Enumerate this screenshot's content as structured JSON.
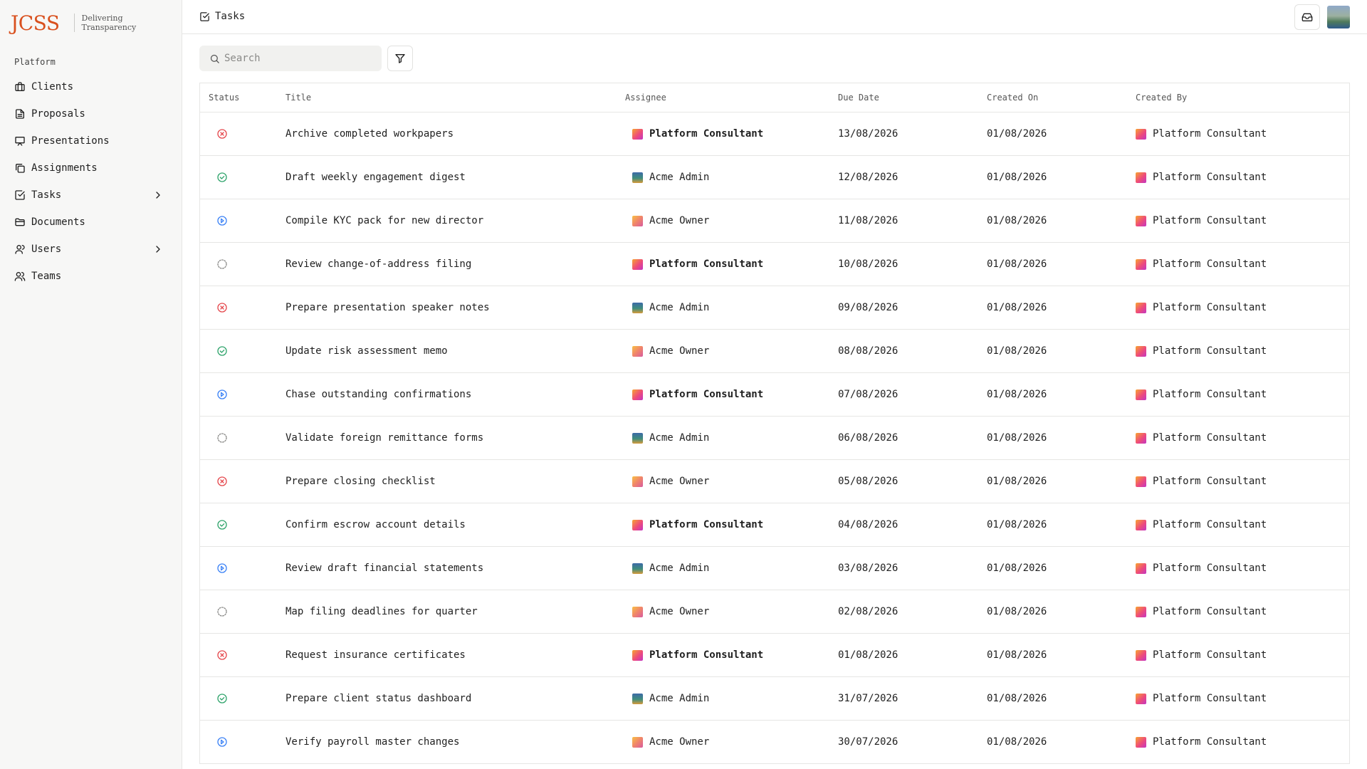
{
  "brand": {
    "logo": "JCSS",
    "tagline_line1": "Delivering",
    "tagline_line2": "Transparency"
  },
  "sidebar": {
    "section_label": "Platform",
    "items": [
      {
        "label": "Clients",
        "icon": "briefcase-icon"
      },
      {
        "label": "Proposals",
        "icon": "file-text-icon"
      },
      {
        "label": "Presentations",
        "icon": "presentation-icon"
      },
      {
        "label": "Assignments",
        "icon": "layers-icon"
      },
      {
        "label": "Tasks",
        "icon": "check-square-icon",
        "has_submenu": true
      },
      {
        "label": "Documents",
        "icon": "folder-icon"
      },
      {
        "label": "Users",
        "icon": "user-icon",
        "has_submenu": true
      },
      {
        "label": "Teams",
        "icon": "users-icon"
      }
    ]
  },
  "header": {
    "title": "Tasks"
  },
  "toolbar": {
    "search_placeholder": "Search"
  },
  "table": {
    "columns": [
      "Status",
      "Title",
      "Assignee",
      "Due Date",
      "Created On",
      "Created By"
    ],
    "rows": [
      {
        "status": "cancelled",
        "title": "Archive completed workpapers",
        "assignee": "Platform Consultant",
        "due": "13/08/2026",
        "created_on": "01/08/2026",
        "created_by": "Platform Consultant"
      },
      {
        "status": "done",
        "title": "Draft weekly engagement digest",
        "assignee": "Acme Admin",
        "due": "12/08/2026",
        "created_on": "01/08/2026",
        "created_by": "Platform Consultant"
      },
      {
        "status": "in-progress",
        "title": "Compile KYC pack for new director",
        "assignee": "Acme Owner",
        "due": "11/08/2026",
        "created_on": "01/08/2026",
        "created_by": "Platform Consultant"
      },
      {
        "status": "todo",
        "title": "Review change-of-address filing",
        "assignee": "Platform Consultant",
        "due": "10/08/2026",
        "created_on": "01/08/2026",
        "created_by": "Platform Consultant"
      },
      {
        "status": "cancelled",
        "title": "Prepare presentation speaker notes",
        "assignee": "Acme Admin",
        "due": "09/08/2026",
        "created_on": "01/08/2026",
        "created_by": "Platform Consultant"
      },
      {
        "status": "done",
        "title": "Update risk assessment memo",
        "assignee": "Acme Owner",
        "due": "08/08/2026",
        "created_on": "01/08/2026",
        "created_by": "Platform Consultant"
      },
      {
        "status": "in-progress",
        "title": "Chase outstanding confirmations",
        "assignee": "Platform Consultant",
        "due": "07/08/2026",
        "created_on": "01/08/2026",
        "created_by": "Platform Consultant"
      },
      {
        "status": "todo",
        "title": "Validate foreign remittance forms",
        "assignee": "Acme Admin",
        "due": "06/08/2026",
        "created_on": "01/08/2026",
        "created_by": "Platform Consultant"
      },
      {
        "status": "cancelled",
        "title": "Prepare closing checklist",
        "assignee": "Acme Owner",
        "due": "05/08/2026",
        "created_on": "01/08/2026",
        "created_by": "Platform Consultant"
      },
      {
        "status": "done",
        "title": "Confirm escrow account details",
        "assignee": "Platform Consultant",
        "due": "04/08/2026",
        "created_on": "01/08/2026",
        "created_by": "Platform Consultant"
      },
      {
        "status": "in-progress",
        "title": "Review draft financial statements",
        "assignee": "Acme Admin",
        "due": "03/08/2026",
        "created_on": "01/08/2026",
        "created_by": "Platform Consultant"
      },
      {
        "status": "todo",
        "title": "Map filing deadlines for quarter",
        "assignee": "Acme Owner",
        "due": "02/08/2026",
        "created_on": "01/08/2026",
        "created_by": "Platform Consultant"
      },
      {
        "status": "cancelled",
        "title": "Request insurance certificates",
        "assignee": "Platform Consultant",
        "due": "01/08/2026",
        "created_on": "01/08/2026",
        "created_by": "Platform Consultant"
      },
      {
        "status": "done",
        "title": "Prepare client status dashboard",
        "assignee": "Acme Admin",
        "due": "31/07/2026",
        "created_on": "01/08/2026",
        "created_by": "Platform Consultant"
      },
      {
        "status": "in-progress",
        "title": "Verify payroll master changes",
        "assignee": "Acme Owner",
        "due": "30/07/2026",
        "created_on": "01/08/2026",
        "created_by": "Platform Consultant"
      }
    ]
  },
  "colors": {
    "brand": "#d9501e",
    "cancelled": "#e5484d",
    "done": "#30a46c",
    "in_progress": "#3b82f6",
    "todo": "#8a8a88"
  }
}
